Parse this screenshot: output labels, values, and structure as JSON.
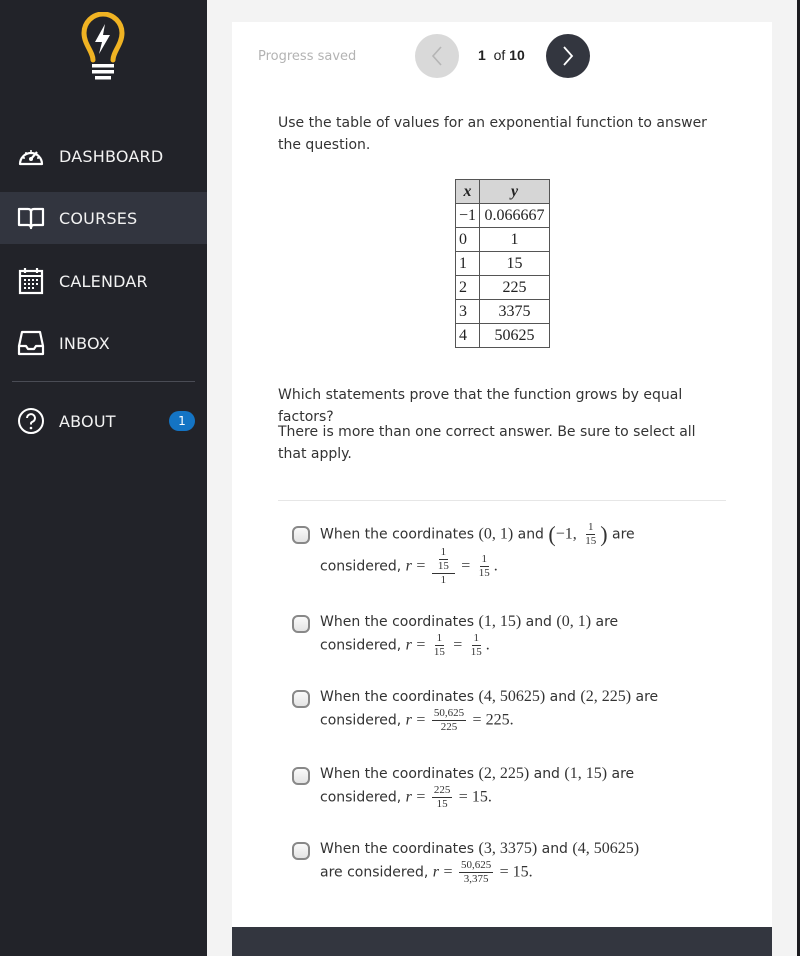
{
  "sidebar": {
    "logo": "lightbulb-logo",
    "items": [
      {
        "label": "DASHBOARD",
        "icon": "speedometer-icon",
        "active": false
      },
      {
        "label": "COURSES",
        "icon": "book-icon",
        "active": true
      },
      {
        "label": "CALENDAR",
        "icon": "calendar-icon",
        "active": false
      },
      {
        "label": "INBOX",
        "icon": "inbox-tray-icon",
        "active": false
      },
      {
        "label": "ABOUT",
        "icon": "question-circle-icon",
        "active": false,
        "badge": "1"
      }
    ]
  },
  "topbar": {
    "status": "Progress saved",
    "page_current": "1",
    "page_of": "of",
    "page_total": "10",
    "prev_icon": "chevron-left-icon",
    "next_icon": "chevron-right-icon"
  },
  "question": {
    "intro": "Use the table of values for an exponential function to answer the question.",
    "table": {
      "headers": [
        "x",
        "y"
      ],
      "rows": [
        [
          "−1",
          "0.066667"
        ],
        [
          "0",
          "1"
        ],
        [
          "1",
          "15"
        ],
        [
          "2",
          "225"
        ],
        [
          "3",
          "3375"
        ],
        [
          "4",
          "50625"
        ]
      ]
    },
    "prompt": "Which statements prove that the function grows by equal factors?",
    "note": "There is more than one correct answer. Be sure to select all that apply."
  },
  "options": [
    {
      "checked": false,
      "lead": "When the coordinates",
      "p1": "(0, 1)",
      "and": "and",
      "p2_prefix": "−1,",
      "p2_frac_num": "1",
      "p2_frac_den": "15",
      "tail": "are considered,",
      "r": "r",
      "eq": "=",
      "f1_num_num": "1",
      "f1_num_den": "15",
      "f1_den": "1",
      "f2_num": "1",
      "f2_den": "15",
      "end": "."
    },
    {
      "checked": false,
      "lead": "When the coordinates",
      "p1": "(1, 15)",
      "and": "and",
      "p2": "(0, 1)",
      "tail": "are considered,",
      "r": "r",
      "eq": "=",
      "f1_num": "1",
      "f1_den": "15",
      "f2_num": "1",
      "f2_den": "15",
      "end": "."
    },
    {
      "checked": false,
      "lead": "When the coordinates",
      "p1": "(4, 50625)",
      "and": "and",
      "p2": "(2, 225)",
      "tail": "are considered,",
      "r": "r",
      "eq": "=",
      "f1_num": "50,625",
      "f1_den": "225",
      "result": "= 225."
    },
    {
      "checked": false,
      "lead": "When the coordinates",
      "p1": "(2, 225)",
      "and": "and",
      "p2": "(1, 15)",
      "tail": "are considered,",
      "r": "r",
      "eq": "=",
      "f1_num": "225",
      "f1_den": "15",
      "result": "= 15."
    },
    {
      "checked": false,
      "lead": "When the coordinates",
      "p1": "(3, 3375)",
      "and": "and",
      "p2": "(4, 50625)",
      "tail": "are considered,",
      "r": "r",
      "eq": "=",
      "f1_num": "50,625",
      "f1_den": "3,375",
      "result": "= 15."
    }
  ],
  "colors": {
    "sidebar_bg": "#222329",
    "sidebar_active": "#32353f",
    "logo_yellow": "#f0b323",
    "badge_blue": "#1474c4",
    "next_button": "#33363f",
    "prev_button": "#d9d9d9"
  }
}
